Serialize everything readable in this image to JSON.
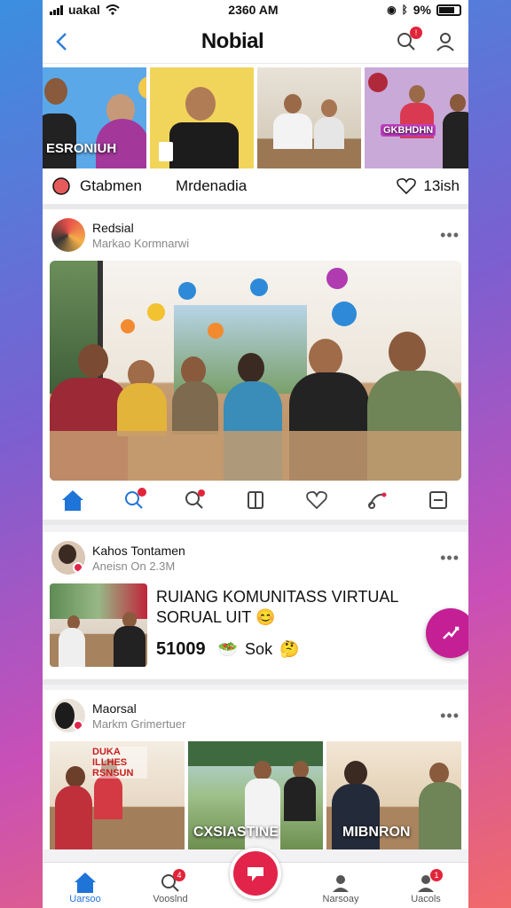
{
  "status_bar": {
    "carrier": "uakal",
    "time": "2360 AM",
    "battery": "9%"
  },
  "header": {
    "title": "Nobial",
    "notification_count": "!"
  },
  "stories": [
    {
      "caption": "ESRONIUH"
    },
    {
      "caption": ""
    },
    {
      "caption": ""
    },
    {
      "caption": "GKBHDHN"
    }
  ],
  "story_tabs": {
    "tab1": "Gtabmen",
    "tab2": "Mrdenadia",
    "likes": "13ish"
  },
  "post1": {
    "name": "Redsial",
    "subtitle": "Markao Kormnarwi",
    "more": "•••"
  },
  "post2": {
    "name": "Kahos Tontamen",
    "subtitle": "Aneisn On 2.3M",
    "more": "•••",
    "headline": "RUIANG KOMUNITASS VIRTUAL SORUAL UIT",
    "stat_value": "51009",
    "stat_sub": "Sok"
  },
  "post3": {
    "name": "Maorsal",
    "subtitle": "Markm Grimertuer",
    "more": "•••",
    "captions": [
      "DUKA ILLHES RSNSUN",
      "CXSIASTINE",
      "MIBNRON"
    ]
  },
  "tabbar": {
    "home": "Uarsoo",
    "search": "Vooslnd",
    "center": "",
    "profile1": "Narsoay",
    "profile2": "Uacols",
    "search_badge": "4",
    "profile_badge": "1"
  }
}
